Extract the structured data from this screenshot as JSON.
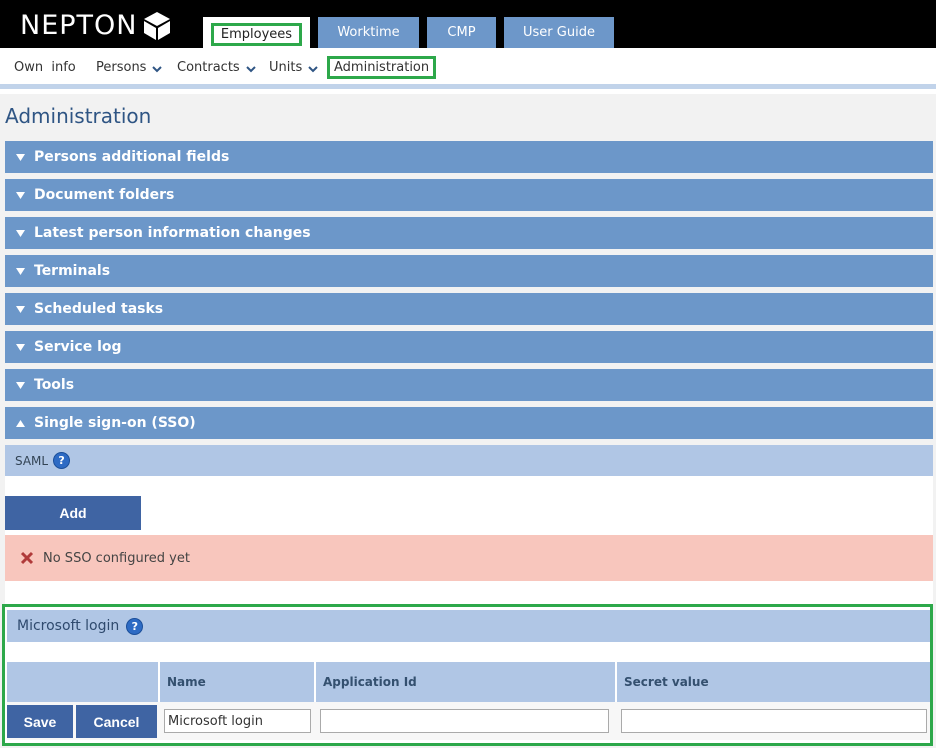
{
  "app": {
    "logo_text": "NEPTON"
  },
  "tabs": [
    {
      "label": "Employees",
      "active": true
    },
    {
      "label": "Worktime"
    },
    {
      "label": "CMP"
    },
    {
      "label": "User Guide"
    }
  ],
  "subnav": {
    "own_info": "Own  info",
    "persons": "Persons",
    "contracts": "Contracts",
    "units": "Units",
    "administration": "Administration"
  },
  "page": {
    "title": "Administration"
  },
  "sections": [
    {
      "label": "Persons additional fields",
      "expanded": false
    },
    {
      "label": "Document folders",
      "expanded": false
    },
    {
      "label": "Latest person information changes",
      "expanded": false
    },
    {
      "label": "Terminals",
      "expanded": false
    },
    {
      "label": "Scheduled tasks",
      "expanded": false
    },
    {
      "label": "Service log",
      "expanded": false
    },
    {
      "label": "Tools",
      "expanded": false
    },
    {
      "label": "Single sign-on (SSO)",
      "expanded": true
    }
  ],
  "sso": {
    "saml_label": "SAML",
    "add_label": "Add",
    "error_text": "No SSO configured yet",
    "microsoft": {
      "title": "Microsoft login",
      "columns": [
        "Name",
        "Application Id",
        "Secret value"
      ],
      "save_label": "Save",
      "cancel_label": "Cancel",
      "name_value": "Microsoft login",
      "application_id_value": "",
      "secret_value": ""
    }
  },
  "colors": {
    "accent_blue": "#6c97c9",
    "button_blue": "#3f64a3",
    "highlight_green": "#2da84a",
    "error_bg": "#f8c6bd"
  },
  "icons": {
    "help": "help-icon",
    "error": "close-x-icon",
    "collapsed": "triangle-down-icon",
    "expanded": "triangle-up-icon"
  }
}
